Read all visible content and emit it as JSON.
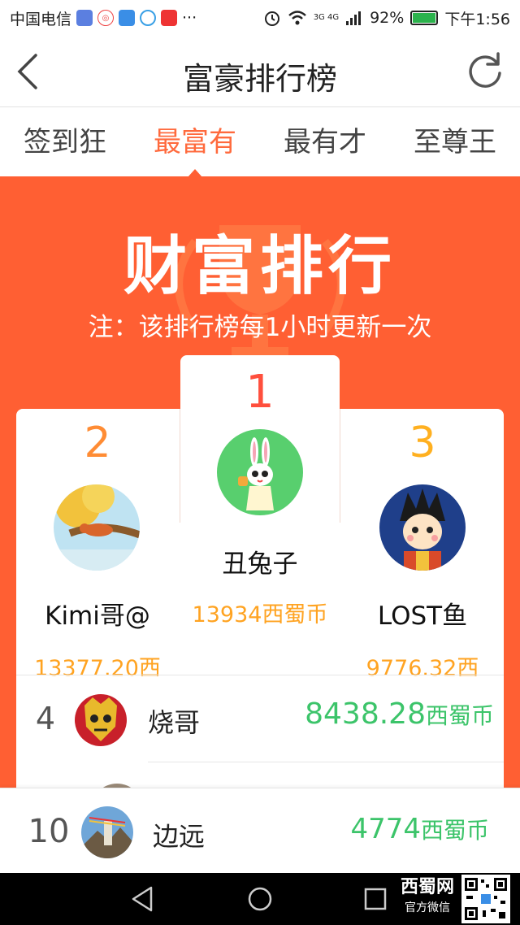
{
  "status_bar": {
    "carrier": "中国电信",
    "battery": "92%",
    "battery_level": 0.92,
    "time": "下午1:56",
    "signal_label": "3G 4G",
    "more": "···"
  },
  "nav": {
    "title": "富豪排行榜",
    "back_icon": "chevron-left-icon",
    "refresh_icon": "refresh-icon"
  },
  "tabs": [
    {
      "label": "签到狂",
      "active": false
    },
    {
      "label": "最富有",
      "active": true
    },
    {
      "label": "最有才",
      "active": false
    },
    {
      "label": "至尊王",
      "active": false
    }
  ],
  "banner": {
    "title": "财富排行",
    "note": "注：该排行榜每1小时更新一次"
  },
  "podium": {
    "first": {
      "rank": "1",
      "name": "丑兔子",
      "coins": "13934西蜀币"
    },
    "second": {
      "rank": "2",
      "name": "Kimi哥@",
      "coins": "13377.20西"
    },
    "third": {
      "rank": "3",
      "name": "LOST鱼",
      "coins": "9776.32西"
    }
  },
  "list": [
    {
      "rank": "4",
      "name": "烧哥",
      "amount": "8438.28",
      "unit": "西蜀币"
    }
  ],
  "self_entry": {
    "rank": "10",
    "name": "边远",
    "amount": "4774",
    "unit": "西蜀币"
  },
  "watermark": {
    "line1": "西蜀网",
    "line2": "官方微信"
  },
  "colors": {
    "accent": "#ff6a3d",
    "banner_bg": "#ff5f33",
    "gold": "#ffa321",
    "green": "#3cc46a",
    "rank1": "#ff4f3d",
    "rank2": "#ff8c34",
    "rank3": "#ffb020"
  }
}
